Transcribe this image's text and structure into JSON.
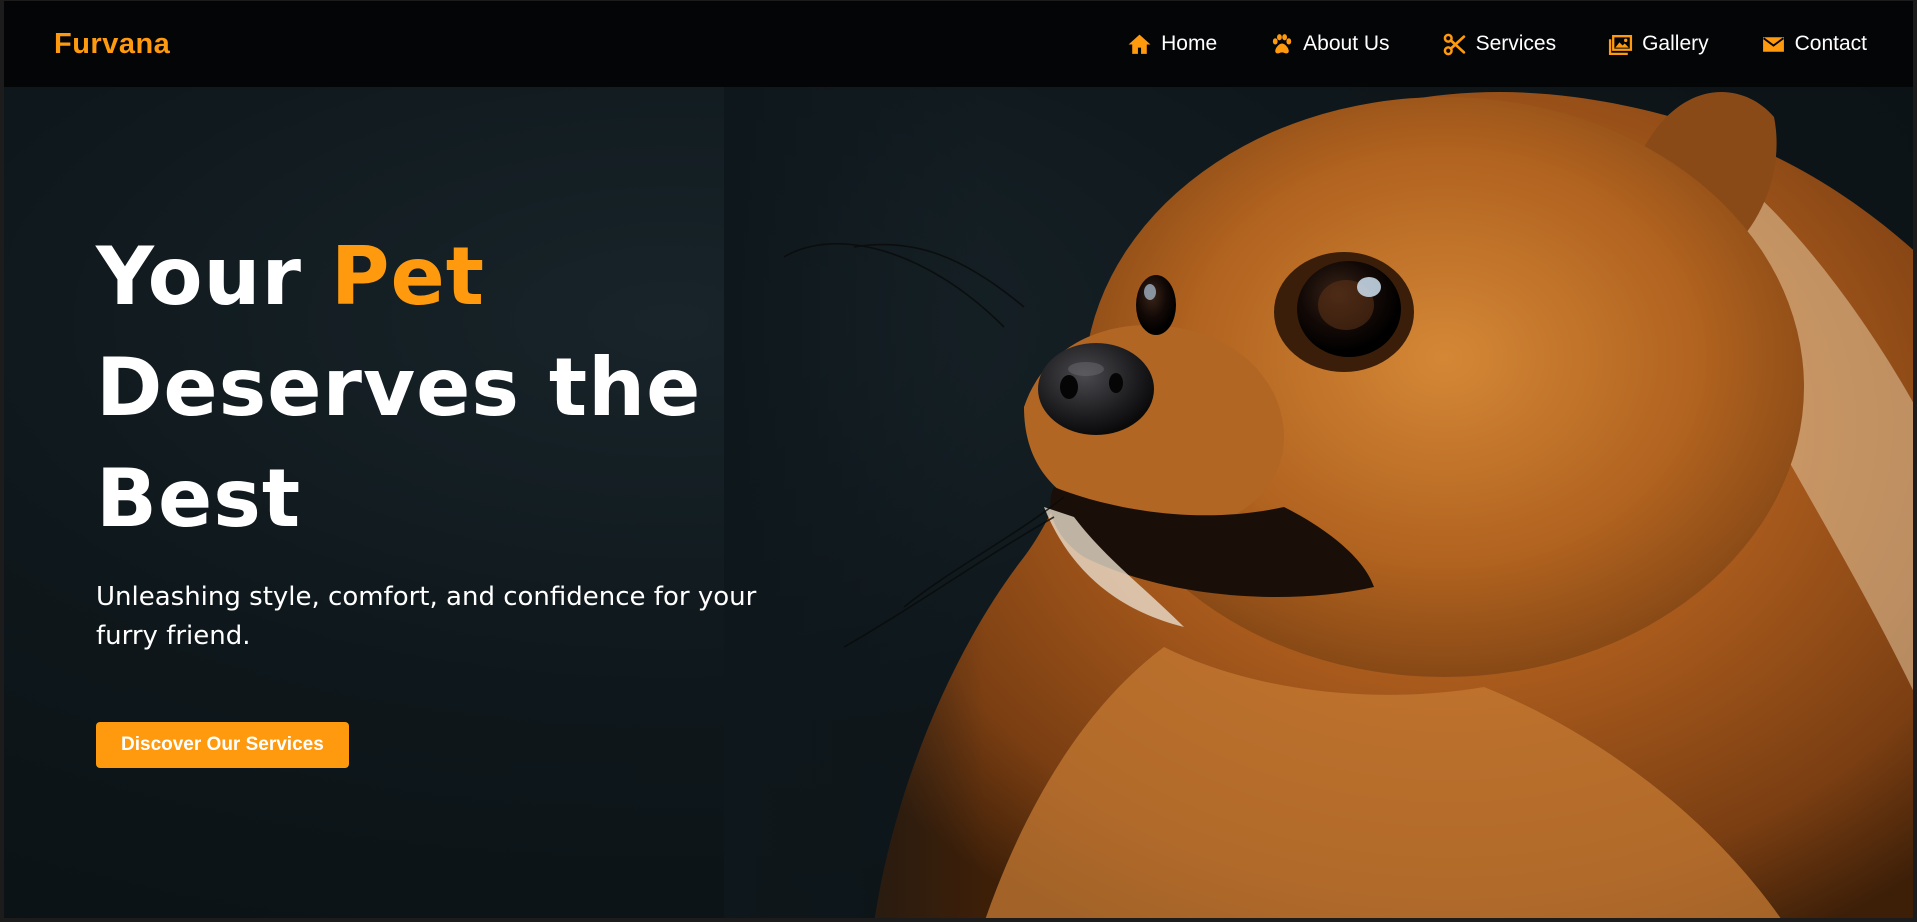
{
  "brand": {
    "name": "Furvana",
    "accent_color": "#ff9a0e"
  },
  "nav": {
    "items": [
      {
        "label": "Home",
        "icon": "home-icon"
      },
      {
        "label": "About Us",
        "icon": "paw-icon"
      },
      {
        "label": "Services",
        "icon": "scissors-icon"
      },
      {
        "label": "Gallery",
        "icon": "gallery-icon"
      },
      {
        "label": "Contact",
        "icon": "envelope-icon"
      }
    ]
  },
  "hero": {
    "title_line1_prefix": "Your ",
    "title_line1_accent": "Pet",
    "title_line2": "Deserves the",
    "title_line3": "Best",
    "subtitle": "Unleashing style, comfort, and confidence for your furry friend.",
    "cta_label": "Discover Our Services",
    "image": "pomeranian-dog-photo"
  },
  "colors": {
    "accent": "#ff9a0e",
    "nav_background": "#040506",
    "hero_background": "#0e171b",
    "text": "#ffffff"
  }
}
